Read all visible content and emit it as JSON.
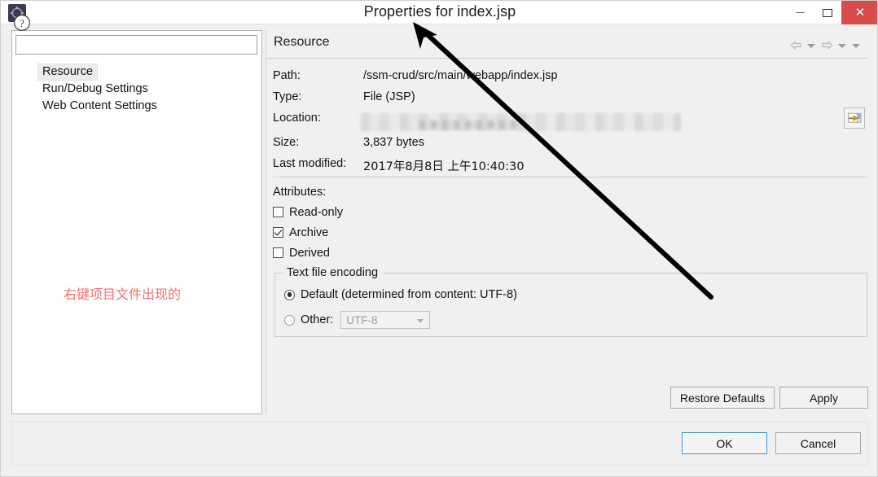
{
  "window": {
    "title": "Properties for index.jsp",
    "icon": "gear-icon",
    "minimize_label": "Minimize",
    "maximize_label": "Maximize",
    "close_label": "Close"
  },
  "sidebar": {
    "filter_value": "",
    "filter_placeholder": "",
    "items": [
      {
        "label": "Resource",
        "selected": true
      },
      {
        "label": "Run/Debug Settings",
        "selected": false
      },
      {
        "label": "Web Content Settings",
        "selected": false
      }
    ],
    "annotation": "右键项目文件出现的"
  },
  "page": {
    "title": "Resource",
    "nav": {
      "back": "back-arrow-icon",
      "back_menu": "chevron-down-icon",
      "forward": "forward-arrow-icon",
      "forward_menu": "chevron-down-icon",
      "view_menu": "chevron-down-icon"
    },
    "details": [
      {
        "label": "Path:",
        "value": "/ssm-crud/src/main/webapp/index.jsp",
        "blurred": false
      },
      {
        "label": "Type:",
        "value": "File  (JSP)",
        "blurred": false
      },
      {
        "label": "Location:",
        "value": "",
        "blurred": true
      },
      {
        "label": "Size:",
        "value": "3,837  bytes",
        "blurred": false
      },
      {
        "label": "Last modified:",
        "value": "2017年8月8日 上午10:40:30",
        "blurred": false
      }
    ],
    "location_button": "resolve-link-icon",
    "attributes": {
      "title": "Attributes:",
      "checkboxes": [
        {
          "label": "Read-only",
          "checked": false
        },
        {
          "label": "Archive",
          "checked": true
        },
        {
          "label": "Derived",
          "checked": false
        }
      ]
    },
    "encoding": {
      "group_label": "Text file encoding",
      "default_label": "Default (determined from content: UTF-8)",
      "default_selected": true,
      "other_label": "Other:",
      "other_selected": false,
      "other_value": "UTF-8",
      "other_options": [
        "UTF-8"
      ],
      "other_enabled": false
    },
    "buttons": {
      "restore_defaults": "Restore Defaults",
      "apply": "Apply"
    }
  },
  "footer": {
    "help": "help-icon",
    "ok": "OK",
    "cancel": "Cancel"
  },
  "colors": {
    "close_button": "#d94a4a",
    "annotation_text": "#f07070",
    "ok_focus_border": "#3c8fd4",
    "dialog_background": "#f0f0f0"
  }
}
